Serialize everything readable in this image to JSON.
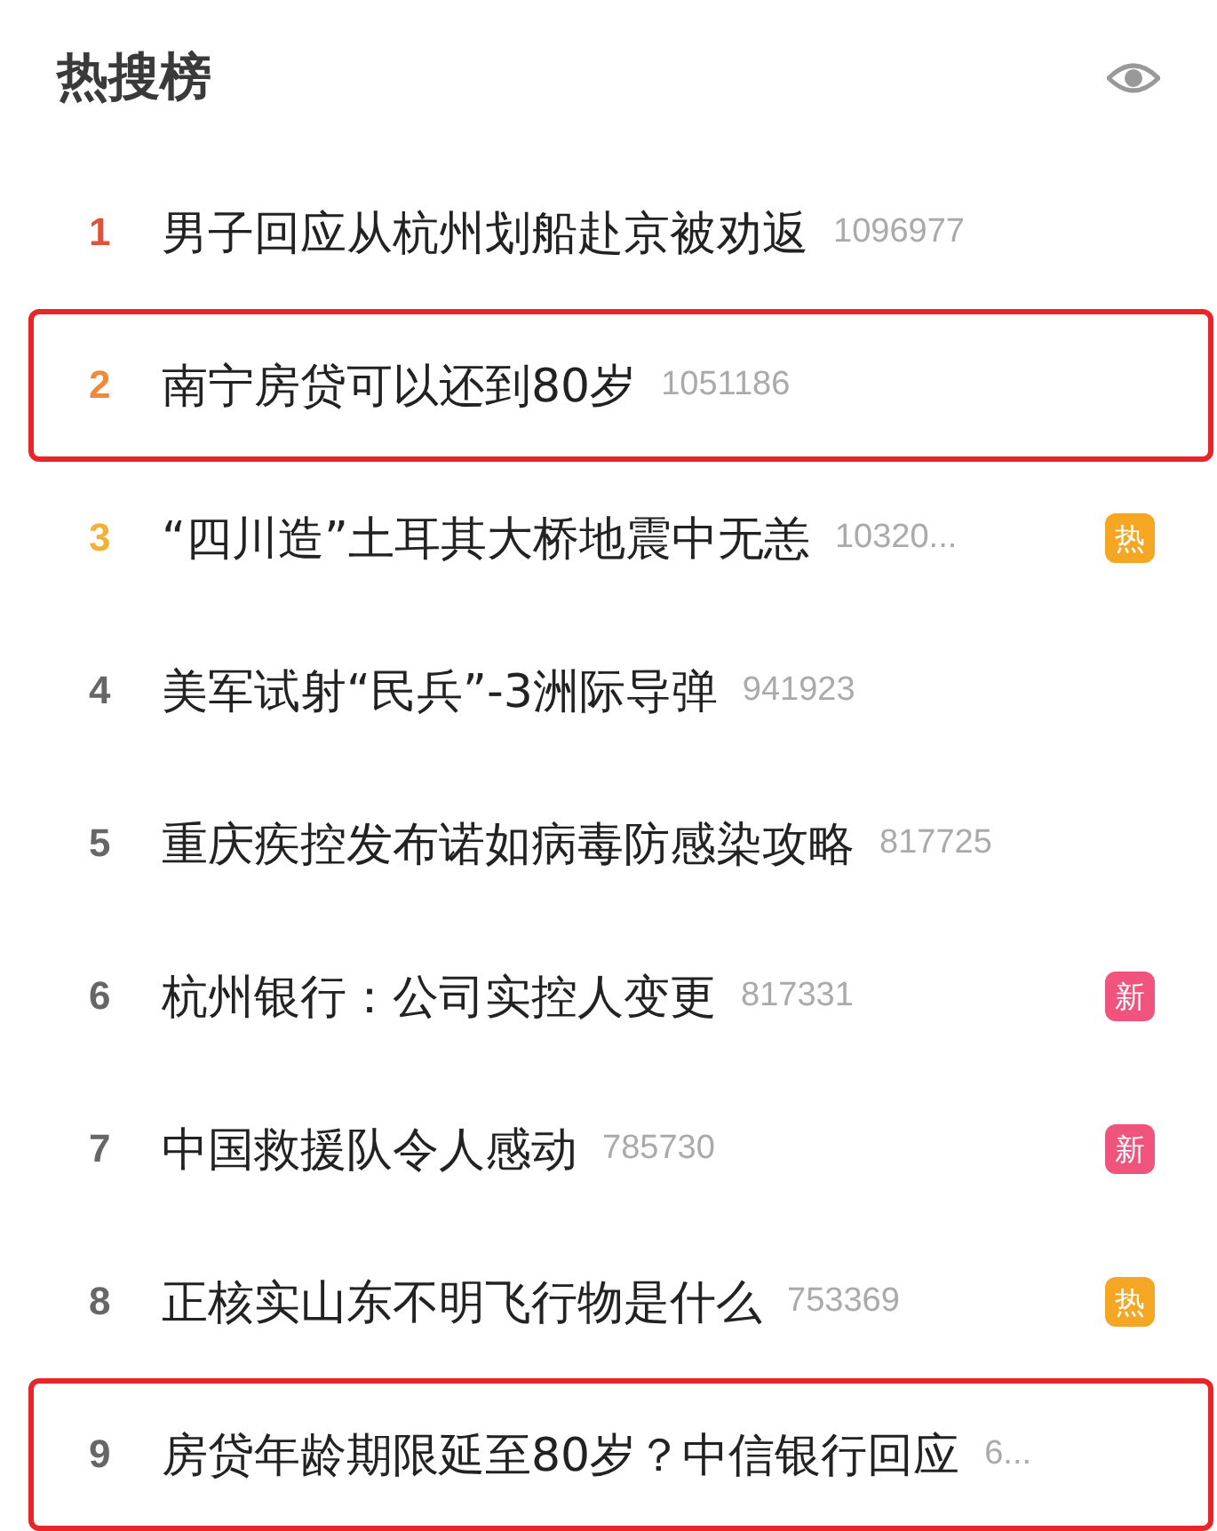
{
  "header": {
    "title": "热搜榜"
  },
  "items": [
    {
      "rank": "1",
      "color": "#e0523a",
      "title": "男子回应从杭州划船赴京被劝返",
      "count": "1096977",
      "highlighted": false
    },
    {
      "rank": "2",
      "color": "#ef8a3c",
      "title": "南宁房贷可以还到80岁",
      "count": "1051186",
      "highlighted": true
    },
    {
      "rank": "3",
      "color": "#f2b134",
      "title": "“四川造”土耳其大桥地震中无恙",
      "count": "10320...",
      "highlighted": false,
      "badge": {
        "kind": "hot",
        "text": "热"
      }
    },
    {
      "rank": "4",
      "color": "#666666",
      "title": "美军试射“民兵”-3洲际导弹",
      "count": "941923",
      "highlighted": false
    },
    {
      "rank": "5",
      "color": "#666666",
      "title": "重庆疾控发布诺如病毒防感染攻略",
      "count": "817725",
      "highlighted": false
    },
    {
      "rank": "6",
      "color": "#666666",
      "title": "杭州银行：公司实控人变更",
      "count": "817331",
      "highlighted": false,
      "badge": {
        "kind": "new",
        "text": "新"
      }
    },
    {
      "rank": "7",
      "color": "#666666",
      "title": "中国救援队令人感动",
      "count": "785730",
      "highlighted": false,
      "badge": {
        "kind": "new",
        "text": "新"
      }
    },
    {
      "rank": "8",
      "color": "#666666",
      "title": "正核实山东不明飞行物是什么",
      "count": "753369",
      "highlighted": false,
      "badge": {
        "kind": "hot",
        "text": "热"
      }
    },
    {
      "rank": "9",
      "color": "#666666",
      "title": "房贷年龄期限延至80岁？中信银行回应",
      "count": "6...",
      "highlighted": true
    }
  ]
}
